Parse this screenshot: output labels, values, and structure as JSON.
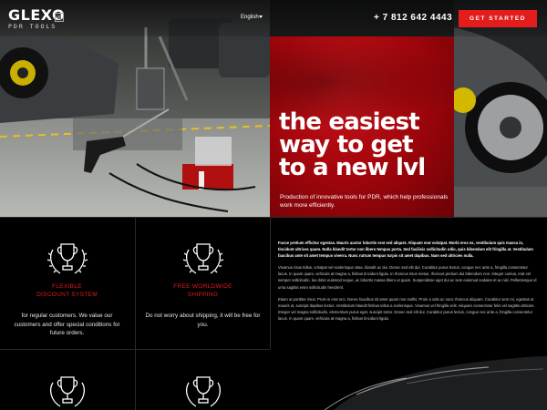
{
  "header": {
    "logo_word": "GLEXO",
    "logo_sub": "PDR TOOLS",
    "language": "English",
    "phone": "+ 7 812 642 4443",
    "cta_label": "GET STARTED"
  },
  "hero": {
    "headline_lines": [
      "the easiest",
      "way to get",
      "to a new lvl"
    ],
    "description": "Production of innovative tools for PDR, which help professionals work more efficiently."
  },
  "features": [
    {
      "title_lines": [
        "FLEXIBLE",
        "DISCOUNT SYSTEM"
      ],
      "description": "for regular customers. We value our customers and offer special conditions for future orders.",
      "icon": "trophy-laurel-icon"
    },
    {
      "title_lines": [
        "FREE WORLDWIDE",
        "SHIPPING"
      ],
      "description": "Do not worry about shipping, it will be free for you.",
      "icon": "trophy-laurel-icon"
    },
    {
      "title_lines": [],
      "description": "",
      "icon": "trophy-laurel-icon"
    },
    {
      "title_lines": [],
      "description": "",
      "icon": "trophy-laurel-icon"
    }
  ],
  "text_block": {
    "paragraphs": [
      "Fusce pretium efficitur egestas. Mauris auctor lobortis erat sed aliquet. Aliquam erat volutpat. Morbi eros ex, vestibulum quis massa in, tincidunt ultrices quam. Nulla blandit tortor non libero tempus porta. Sed facilisis sollicitudin odio, quis bibendum elit fringilla at. Vestibulum faucibus ante sit amet tempus viverra. Nunc rutrum tempus turpis sit amet dapibus. Nam sed ultricies nulla.",
      "Vivamus risus tellus, volutpat vel scelerisque vitae, blandit ac dui. Donec sed elit dui. Curabitur purus lectus, congue nec ante a, fringilla consectetur lacus. In quam quam, vehicula at magna a, finibus tincidunt ligula. In rhoncus risus metus, rhoncus pretium dui bibendum non. Integer cursus, erat vel semper sollicitudin, leo dolor euismod neque, ac lobortis massa libero ut quam. Suspendisse eget dui ac sem euismod sodales et ac nisl. Pellentesque id urna sagittis enim sollicitudin hendrerit.",
      "Etiam ut porttitor risus. Proin in erat orci. Donec faucibus sit amet quam non mollis. Proin a odio ac nunc rhoncus aliquam. Curabitur sem mi, egestas ut mauris ut, suscipit dapibus lectus. Vestibulum blandit finibus tellus a scelerisque. Vivamus vel fringilla velit. Aliquam consectetur felis vel sagittis ultricies. Integer vel magna sollicitudin, elementum purus eget, suscipit tortor. Donec sed elit dui. Curabitur purus lectus, congue nec ante a, fringilla consectetur lacus. In quam quam, vehicula at magna a, finibus tincidunt ligula."
    ]
  },
  "colors": {
    "accent": "#e41c1c",
    "panel_red": "#a4060c",
    "background": "#000000",
    "grid_line": "#2a2a2a"
  }
}
